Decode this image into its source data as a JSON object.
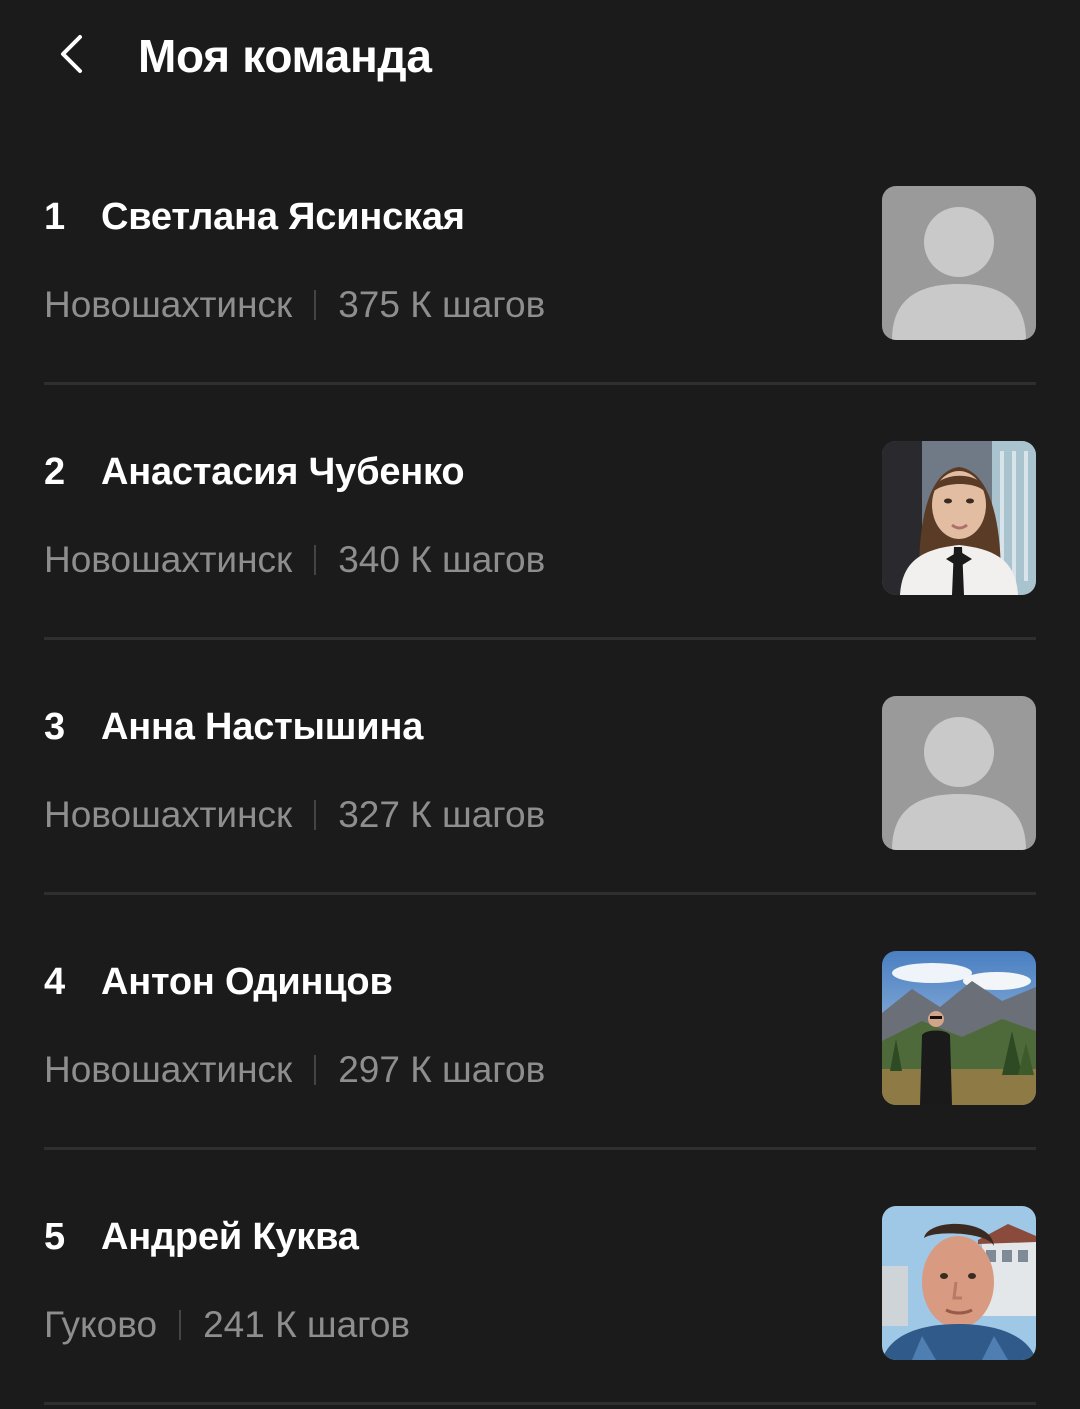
{
  "header": {
    "title": "Моя команда",
    "back_icon": "chevron-left-icon"
  },
  "members": [
    {
      "rank": "1",
      "name": "Светлана Ясинская",
      "city": "Новошахтинск",
      "steps": "375 К шагов",
      "avatar": "placeholder"
    },
    {
      "rank": "2",
      "name": "Анастасия Чубенко",
      "city": "Новошахтинск",
      "steps": "340 К шагов",
      "avatar": "photo-woman"
    },
    {
      "rank": "3",
      "name": "Анна Настышина",
      "city": "Новошахтинск",
      "steps": "327 К шагов",
      "avatar": "placeholder"
    },
    {
      "rank": "4",
      "name": "Антон Одинцов",
      "city": "Новошахтинск",
      "steps": "297 К шагов",
      "avatar": "photo-mountains"
    },
    {
      "rank": "5",
      "name": "Андрей Куква",
      "city": "Гуково",
      "steps": "241 К шагов",
      "avatar": "photo-man"
    }
  ],
  "colors": {
    "background": "#1b1b1b",
    "text_primary": "#ffffff",
    "text_secondary": "#8e8e8e",
    "divider": "#2f2f2f",
    "placeholder_bg": "#9a9a9a",
    "placeholder_fg": "#c9c9c9"
  }
}
